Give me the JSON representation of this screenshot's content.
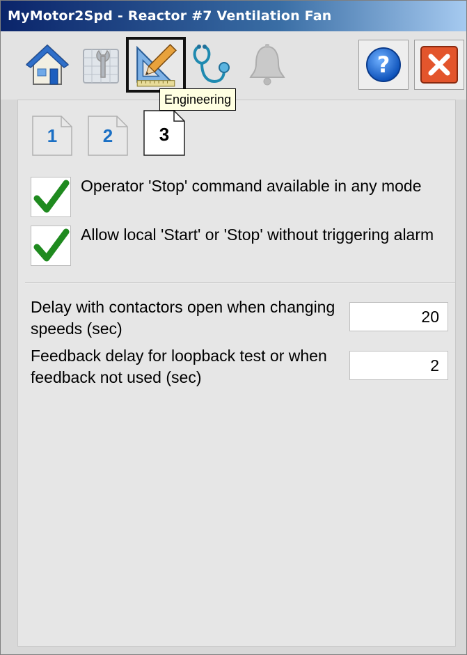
{
  "window": {
    "title": "MyMotor2Spd - Reactor #7 Ventilation Fan"
  },
  "toolbar": {
    "tabs": [
      {
        "icon": "home-icon"
      },
      {
        "icon": "maintenance-icon"
      },
      {
        "icon": "engineering-icon",
        "selected": true
      },
      {
        "icon": "diagnostics-icon"
      },
      {
        "icon": "alarm-bell-icon"
      }
    ],
    "tooltip": "Engineering",
    "help_icon": "help-icon",
    "close_icon": "close-icon"
  },
  "pages": [
    {
      "label": "1"
    },
    {
      "label": "2"
    },
    {
      "label": "3"
    }
  ],
  "options": [
    {
      "label": "Operator 'Stop' command available in any mode",
      "checked": true
    },
    {
      "label": "Allow local 'Start' or 'Stop' without triggering alarm",
      "checked": true
    }
  ],
  "fields": [
    {
      "label": "Delay with contactors open when changing speeds (sec)",
      "value": "20"
    },
    {
      "label": "Feedback delay for loopback test or when feedback not used (sec)",
      "value": "2"
    }
  ],
  "colors": {
    "accent_blue": "#1a6fc4",
    "check_green": "#1f8a1f",
    "close_red": "#d9401f"
  }
}
